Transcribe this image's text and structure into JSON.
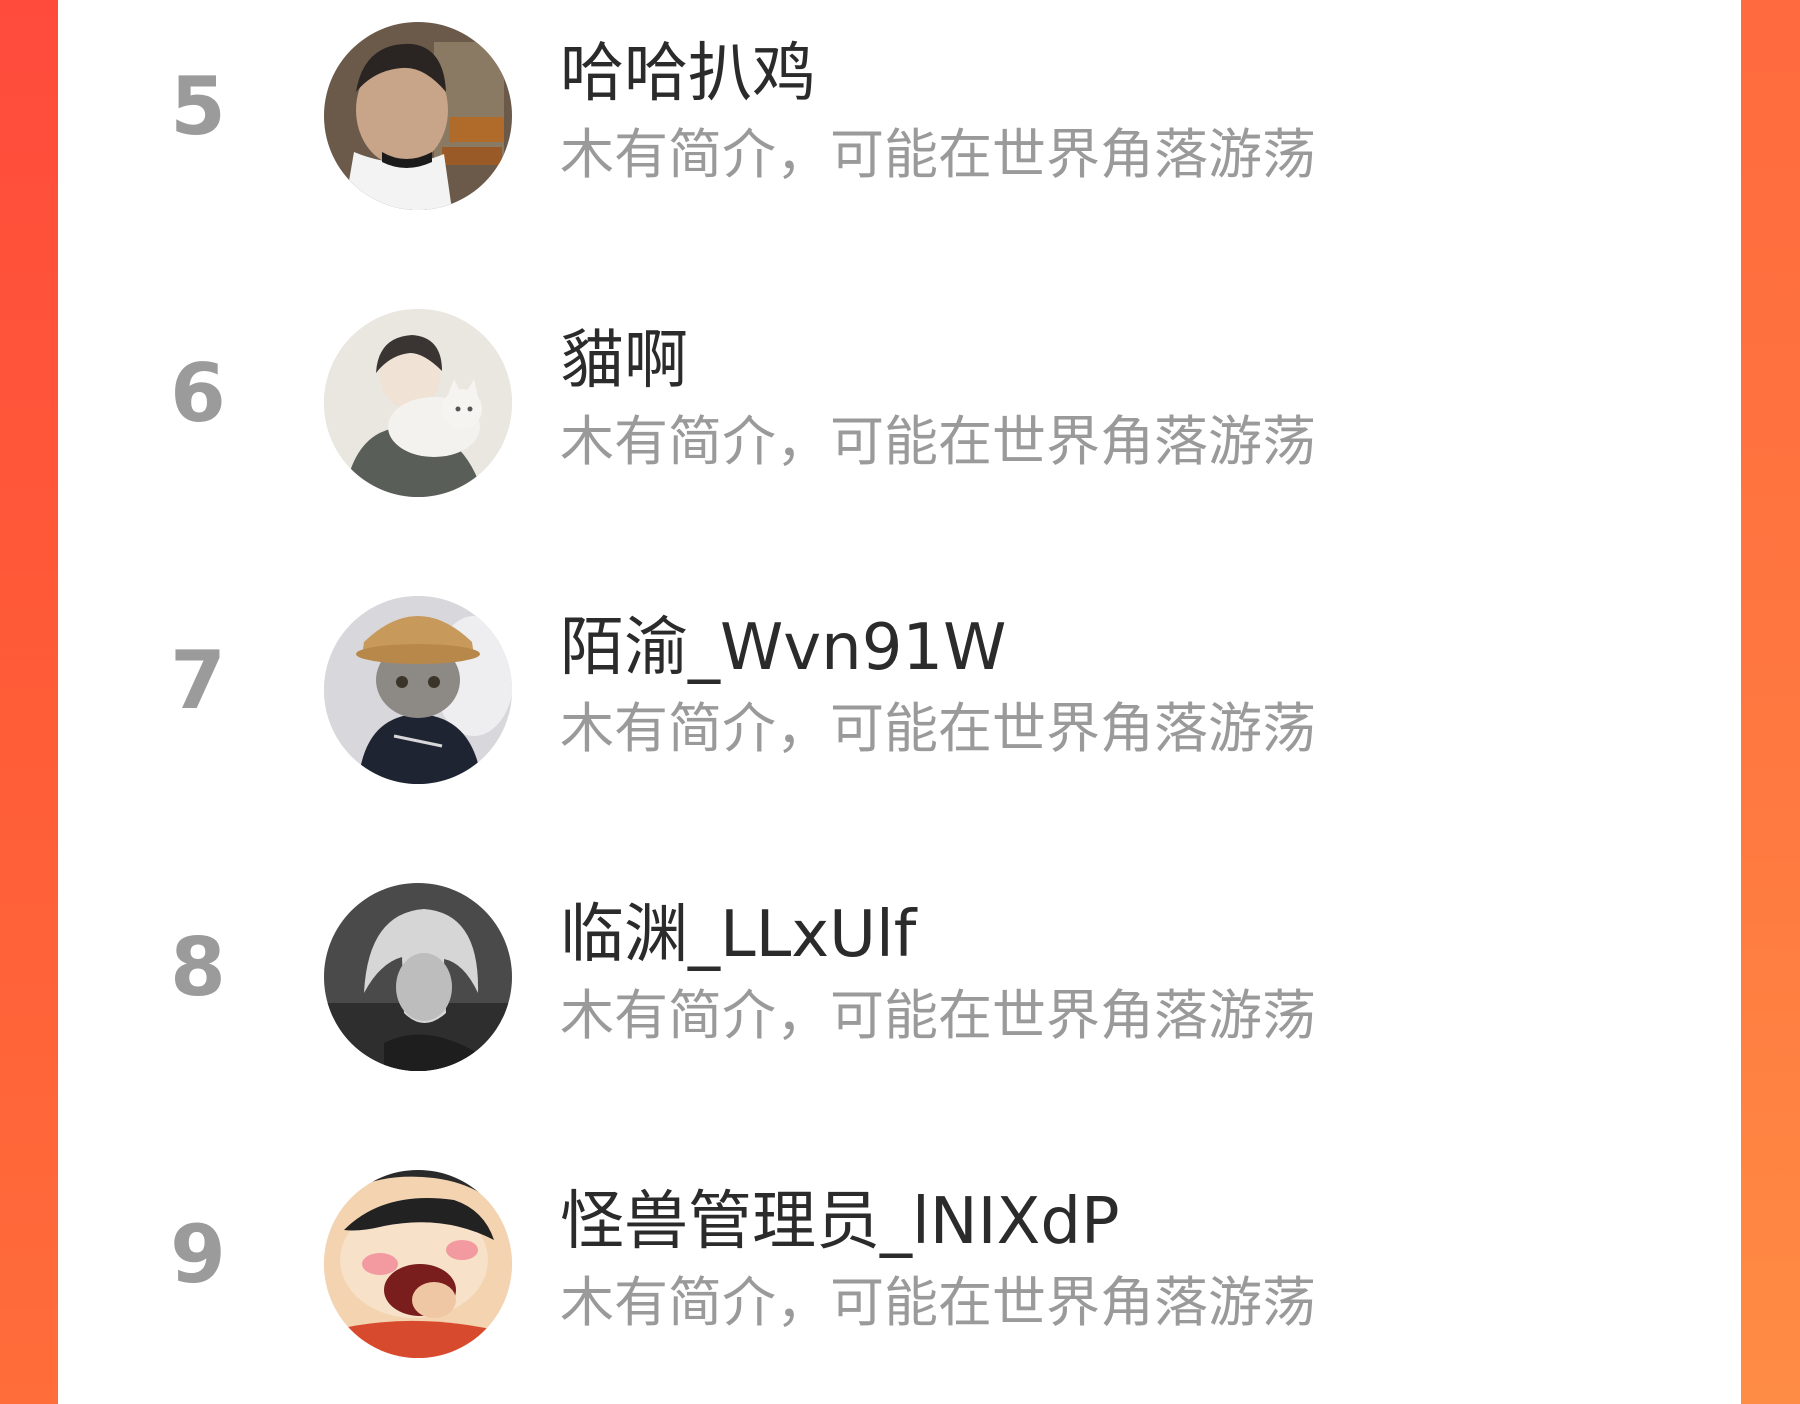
{
  "ranking": {
    "items": [
      {
        "rank": "5",
        "name": "哈哈扒鸡",
        "bio": "木有简介，可能在世界角落游荡",
        "avatar_icon": "barber-haircut-photo-avatar"
      },
      {
        "rank": "6",
        "name": "貓啊",
        "bio": "木有简介，可能在世界角落游荡",
        "avatar_icon": "anime-boy-with-cat-avatar"
      },
      {
        "rank": "7",
        "name": "陌渝_Wvn91W",
        "bio": "木有简介，可能在世界角落游荡",
        "avatar_icon": "cat-in-hat-avatar"
      },
      {
        "rank": "8",
        "name": "临渊_LLxUlf",
        "bio": "木有简介，可能在世界角落游荡",
        "avatar_icon": "grayscale-anime-character-avatar"
      },
      {
        "rank": "9",
        "name": "怪兽管理员_lNIXdP",
        "bio": "木有简介，可能在世界角落游荡",
        "avatar_icon": "cartoon-crayon-shinchan-avatar"
      }
    ]
  },
  "colors": {
    "background_accent": "#ff4b3c",
    "rank_number": "#9b9b9b",
    "name_text": "#2b2b2b",
    "bio_text": "#9a9a9a"
  }
}
